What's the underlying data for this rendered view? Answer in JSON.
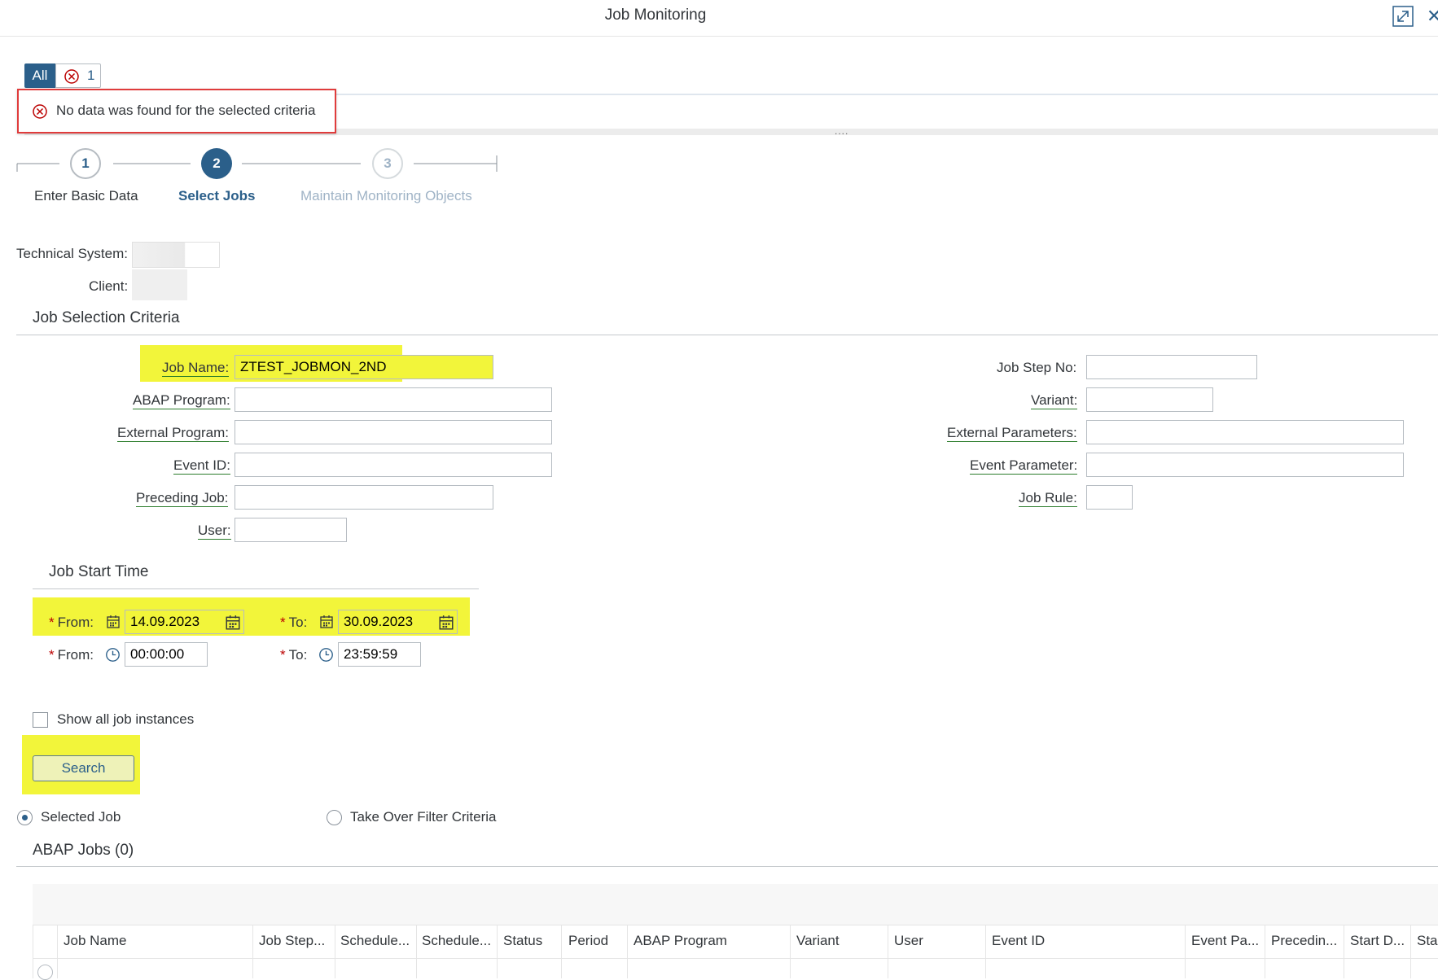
{
  "window": {
    "title": "Job Monitoring"
  },
  "messages": {
    "filter_all": "All",
    "error_count": "1",
    "error_text": "No data was found for the selected criteria"
  },
  "steps": [
    {
      "number": "1",
      "label": "Enter Basic Data"
    },
    {
      "number": "2",
      "label": "Select Jobs"
    },
    {
      "number": "3",
      "label": "Maintain Monitoring Objects"
    }
  ],
  "system": {
    "technical_system_label": "Technical System:",
    "client_label": "Client:"
  },
  "job_selection": {
    "title": "Job Selection Criteria",
    "job_name_label": "Job Name:",
    "job_name_value": "ZTEST_JOBMON_2ND",
    "abap_program_label": "ABAP Program:",
    "external_program_label": "External Program:",
    "event_id_label": "Event ID:",
    "preceding_job_label": "Preceding Job:",
    "user_label": "User:",
    "job_step_no_label": "Job Step No:",
    "variant_label": "Variant:",
    "external_parameters_label": "External Parameters:",
    "event_parameter_label": "Event Parameter:",
    "job_rule_label": "Job Rule:"
  },
  "job_start_time": {
    "title": "Job Start Time",
    "required_mark": "*",
    "from_label": "From:",
    "to_label": "To:",
    "from_date": "14.09.2023",
    "to_date": "30.09.2023",
    "from_time": "00:00:00",
    "to_time": "23:59:59"
  },
  "options": {
    "show_all_instances_label": "Show all job instances",
    "search_label": "Search",
    "selected_job_label": "Selected Job",
    "take_over_label": "Take Over Filter Criteria"
  },
  "abap_jobs": {
    "title": "ABAP Jobs (0)",
    "columns": [
      "Job Name",
      "Job Step...",
      "Schedule...",
      "Schedule...",
      "Status",
      "Period",
      "ABAP Program",
      "Variant",
      "User",
      "Event ID",
      "Event Pa...",
      "Precedin...",
      "Start D...",
      "Star"
    ]
  },
  "colors": {
    "accent": "#2b5f8a",
    "error": "#bb0000",
    "highlight": "#f2f53a",
    "callout_border": "#e03c3c"
  }
}
